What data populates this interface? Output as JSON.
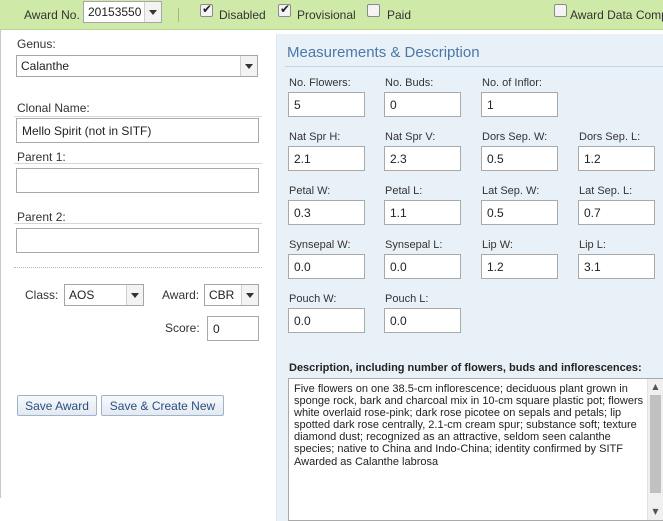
{
  "topbar": {
    "award_no_label": "Award No.",
    "award_no_value": "20153550",
    "disabled_label": "Disabled",
    "disabled_checked": true,
    "provisional_label": "Provisional",
    "provisional_checked": true,
    "paid_label": "Paid",
    "paid_checked": false,
    "award_data_complete_label": "Award Data Compl",
    "award_data_complete_checked": false
  },
  "left": {
    "genus_label": "Genus:",
    "genus_value": "Calanthe",
    "clonal_name_label": "Clonal Name:",
    "clonal_name_value": "Mello Spirit  (not in SITF)",
    "parent1_label": "Parent 1:",
    "parent1_value": "",
    "parent2_label": "Parent 2:",
    "parent2_value": "",
    "class_label": "Class:",
    "class_value": "AOS",
    "award_label": "Award:",
    "award_value": "CBR",
    "score_label": "Score:",
    "score_value": "0",
    "save_award_label": "Save Award",
    "save_create_new_label": "Save & Create New"
  },
  "measurements": {
    "title": "Measurements & Description",
    "rows": [
      [
        {
          "label": "No. Flowers:",
          "value": "5"
        },
        {
          "label": "No. Buds:",
          "value": "0"
        },
        {
          "label": "No. of Inflor:",
          "value": "1"
        }
      ],
      [
        {
          "label": "Nat Spr H:",
          "value": "2.1"
        },
        {
          "label": "Nat Spr V:",
          "value": "2.3"
        },
        {
          "label": "Dors Sep. W:",
          "value": "0.5"
        },
        {
          "label": "Dors Sep. L:",
          "value": "1.2"
        }
      ],
      [
        {
          "label": "Petal W:",
          "value": "0.3"
        },
        {
          "label": "Petal L:",
          "value": "1.1"
        },
        {
          "label": "Lat Sep. W:",
          "value": "0.5"
        },
        {
          "label": "Lat Sep. L:",
          "value": "0.7"
        }
      ],
      [
        {
          "label": "Synsepal W:",
          "value": "0.0"
        },
        {
          "label": "Synsepal L:",
          "value": "0.0"
        },
        {
          "label": "Lip W:",
          "value": "1.2"
        },
        {
          "label": "Lip L:",
          "value": "3.1"
        }
      ],
      [
        {
          "label": "Pouch W:",
          "value": "0.0"
        },
        {
          "label": "Pouch L:",
          "value": "0.0"
        }
      ]
    ],
    "description_label": "Description, including number of flowers, buds and inflorescences:",
    "description_text": "Five flowers on one 38.5-cm inflorescence; deciduous plant grown in\nsponge rock, bark and charcoal mix in 10-cm square plastic pot; flowers\nwhite overlaid rose-pink; dark rose picotee on sepals and petals; lip\nspotted dark rose centrally, 2.1-cm cream spur; substance soft; texture\ndiamond dust; recognized as an attractive, seldom seen calanthe\nspecies; native to China and Indo-China; identity confirmed by SITF\nAwarded as Calanthe labrosa"
  },
  "colors": {
    "topbar_bg": "#cfeaa8",
    "panel_bg": "#e9f1f8",
    "title_color": "#4a78a8",
    "button_text": "#2b4f7f"
  },
  "icons": {
    "checkbox": "check-mark",
    "dropdown": "chevron-down",
    "scroll_up": "triangle-up",
    "scroll_down": "triangle-down"
  }
}
